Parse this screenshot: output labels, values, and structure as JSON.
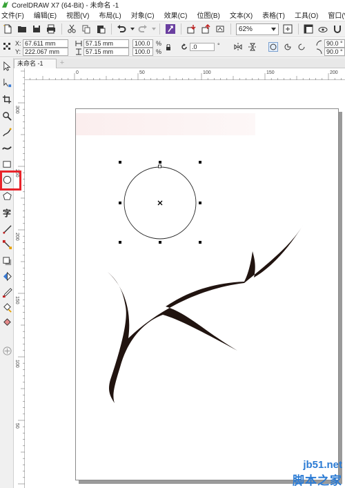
{
  "window": {
    "title": "CorelDRAW X7 (64-Bit) - 未命名 -1",
    "logo_icon": "coreldraw-logo-icon"
  },
  "menu": [
    {
      "label": "文件(F)"
    },
    {
      "label": "编辑(E)"
    },
    {
      "label": "视图(V)"
    },
    {
      "label": "布局(L)"
    },
    {
      "label": "对象(C)"
    },
    {
      "label": "效果(C)"
    },
    {
      "label": "位图(B)"
    },
    {
      "label": "文本(X)"
    },
    {
      "label": "表格(T)"
    },
    {
      "label": "工具(O)"
    },
    {
      "label": "窗口(W)"
    }
  ],
  "standard_toolbar": {
    "zoom_level": "62%"
  },
  "property_bar": {
    "x_label": "X:",
    "x_value": "67.611 mm",
    "y_label": "Y:",
    "y_value": "222.067 mm",
    "width_value": "57.15 mm",
    "height_value": "57.15 mm",
    "scale_x": "100.0",
    "scale_y": "100.0",
    "percent": "%",
    "rotation": ".0",
    "start_angle": "90.0 °",
    "end_angle": "90.0 °"
  },
  "document_tab": {
    "label": "未命名 -1",
    "add_symbol": "+"
  },
  "ruler": {
    "h_ticks": [
      {
        "label": "0"
      },
      {
        "label": "50"
      },
      {
        "label": "100"
      },
      {
        "label": "150"
      },
      {
        "label": "200"
      }
    ],
    "v_ticks": [
      {
        "label": "300"
      },
      {
        "label": "250"
      },
      {
        "label": "200"
      },
      {
        "label": "150"
      },
      {
        "label": "100"
      },
      {
        "label": "50"
      }
    ]
  },
  "toolbox": {
    "tools": [
      {
        "icon": "pick-tool-icon"
      },
      {
        "icon": "shape-tool-icon"
      },
      {
        "icon": "crop-tool-icon"
      },
      {
        "icon": "zoom-tool-icon"
      },
      {
        "icon": "freehand-tool-icon"
      },
      {
        "icon": "artistic-media-icon"
      },
      {
        "icon": "rectangle-tool-icon"
      },
      {
        "icon": "ellipse-tool-icon"
      },
      {
        "icon": "polygon-tool-icon"
      },
      {
        "icon": "text-tool-icon",
        "glyph": "字"
      },
      {
        "icon": "parallel-dimension-icon"
      },
      {
        "icon": "connector-tool-icon"
      },
      {
        "icon": "drop-shadow-icon"
      },
      {
        "icon": "transparency-icon"
      },
      {
        "icon": "color-eyedropper-icon"
      },
      {
        "icon": "interactive-fill-icon"
      },
      {
        "icon": "smart-fill-icon"
      },
      {
        "icon": "add-tool-icon"
      }
    ],
    "highlight_color": "#e8242a"
  },
  "watermark": {
    "site": "jb51.net",
    "name": "脚本之家",
    "color": "#2b7bd4"
  }
}
